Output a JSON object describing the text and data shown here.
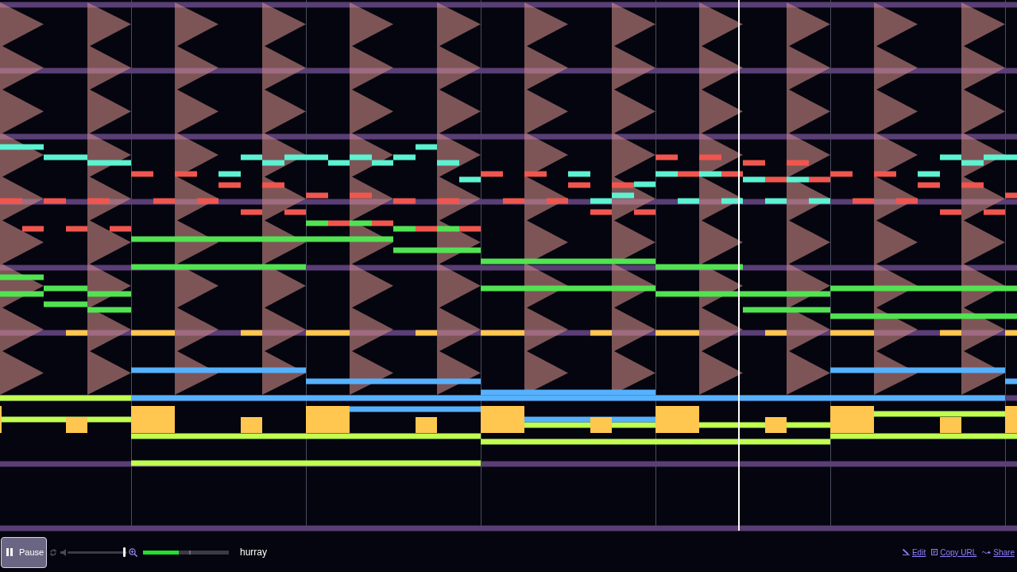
{
  "controls": {
    "play_button": {
      "label": "Pause",
      "playing": true,
      "focused": true
    },
    "loop": {
      "on": false
    },
    "volume": {
      "level": 0.97
    },
    "progress": {
      "level": 0.42,
      "marker": {
        "level": 0.54
      }
    }
  },
  "song_title": "hurray",
  "links": [
    {
      "kind": "edit",
      "label": "Edit"
    },
    {
      "kind": "copy",
      "label": "Copy URL"
    },
    {
      "kind": "share",
      "label": "Share"
    }
  ]
}
